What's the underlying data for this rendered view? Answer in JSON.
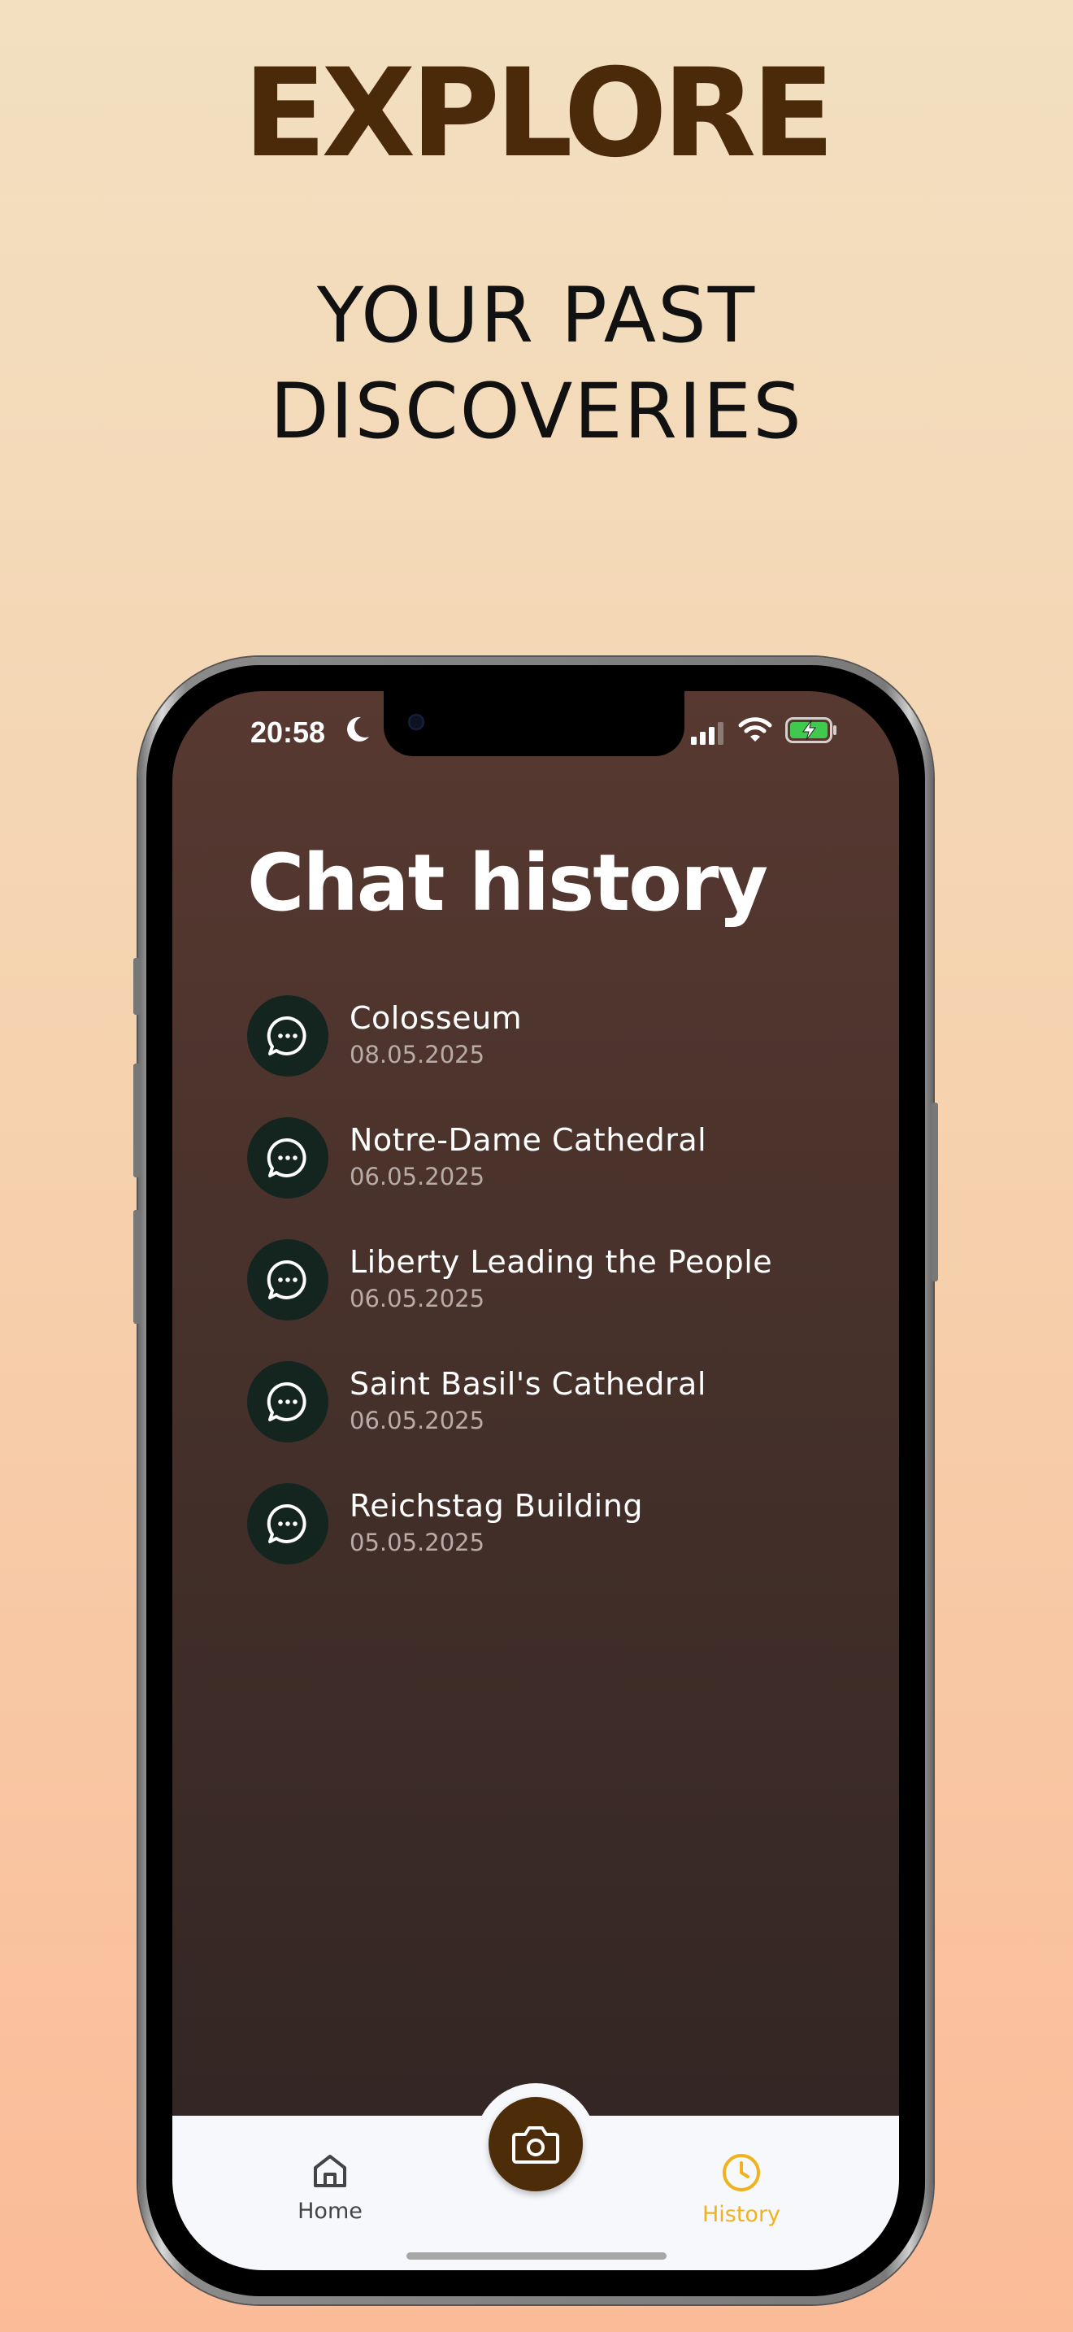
{
  "promo": {
    "headline": "EXPLORE",
    "subheadline_line1": "YOUR PAST",
    "subheadline_line2": "DISCOVERIES"
  },
  "status_bar": {
    "time": "20:58",
    "icons": [
      "moon-icon",
      "signal-icon",
      "wifi-icon",
      "battery-charging-icon"
    ]
  },
  "screen": {
    "title": "Chat history"
  },
  "chats": [
    {
      "name": "Colosseum",
      "date": "08.05.2025"
    },
    {
      "name": "Notre-Dame Cathedral",
      "date": "06.05.2025"
    },
    {
      "name": "Liberty Leading the People",
      "date": "06.05.2025"
    },
    {
      "name": "Saint Basil's Cathedral",
      "date": "06.05.2025"
    },
    {
      "name": "Reichstag Building",
      "date": "05.05.2025"
    }
  ],
  "tab_bar": {
    "home_label": "Home",
    "history_label": "History",
    "active_tab": "History",
    "center_button_icon": "camera-icon"
  },
  "colors": {
    "accent": "#f0b21f",
    "headline": "#4a2a08",
    "fab": "#4d2c0a",
    "avatar_bg": "#142520"
  }
}
